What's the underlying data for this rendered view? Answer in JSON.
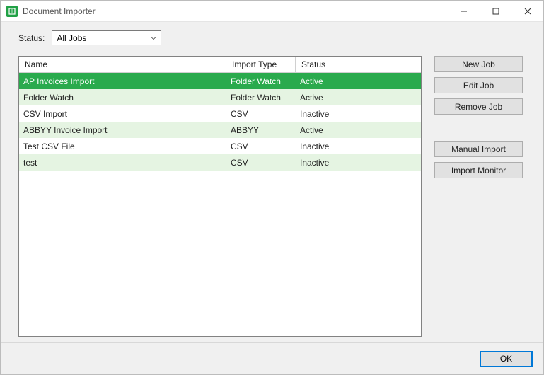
{
  "window_title": "Document Importer",
  "filter": {
    "label": "Status:",
    "selected": "All Jobs"
  },
  "columns": {
    "name": "Name",
    "import_type": "Import Type",
    "status": "Status"
  },
  "rows": [
    {
      "name": "AP Invoices Import",
      "import_type": "Folder Watch",
      "status": "Active",
      "selected": true
    },
    {
      "name": "Folder Watch",
      "import_type": "Folder Watch",
      "status": "Active",
      "selected": false
    },
    {
      "name": "CSV Import",
      "import_type": "CSV",
      "status": "Inactive",
      "selected": false
    },
    {
      "name": "ABBYY Invoice Import",
      "import_type": "ABBYY",
      "status": "Active",
      "selected": false
    },
    {
      "name": "Test CSV File",
      "import_type": "CSV",
      "status": "Inactive",
      "selected": false
    },
    {
      "name": "test",
      "import_type": "CSV",
      "status": "Inactive",
      "selected": false
    }
  ],
  "buttons": {
    "new_job": "New Job",
    "edit_job": "Edit Job",
    "remove_job": "Remove Job",
    "manual_import": "Manual Import",
    "import_monitor": "Import Monitor",
    "ok": "OK"
  }
}
